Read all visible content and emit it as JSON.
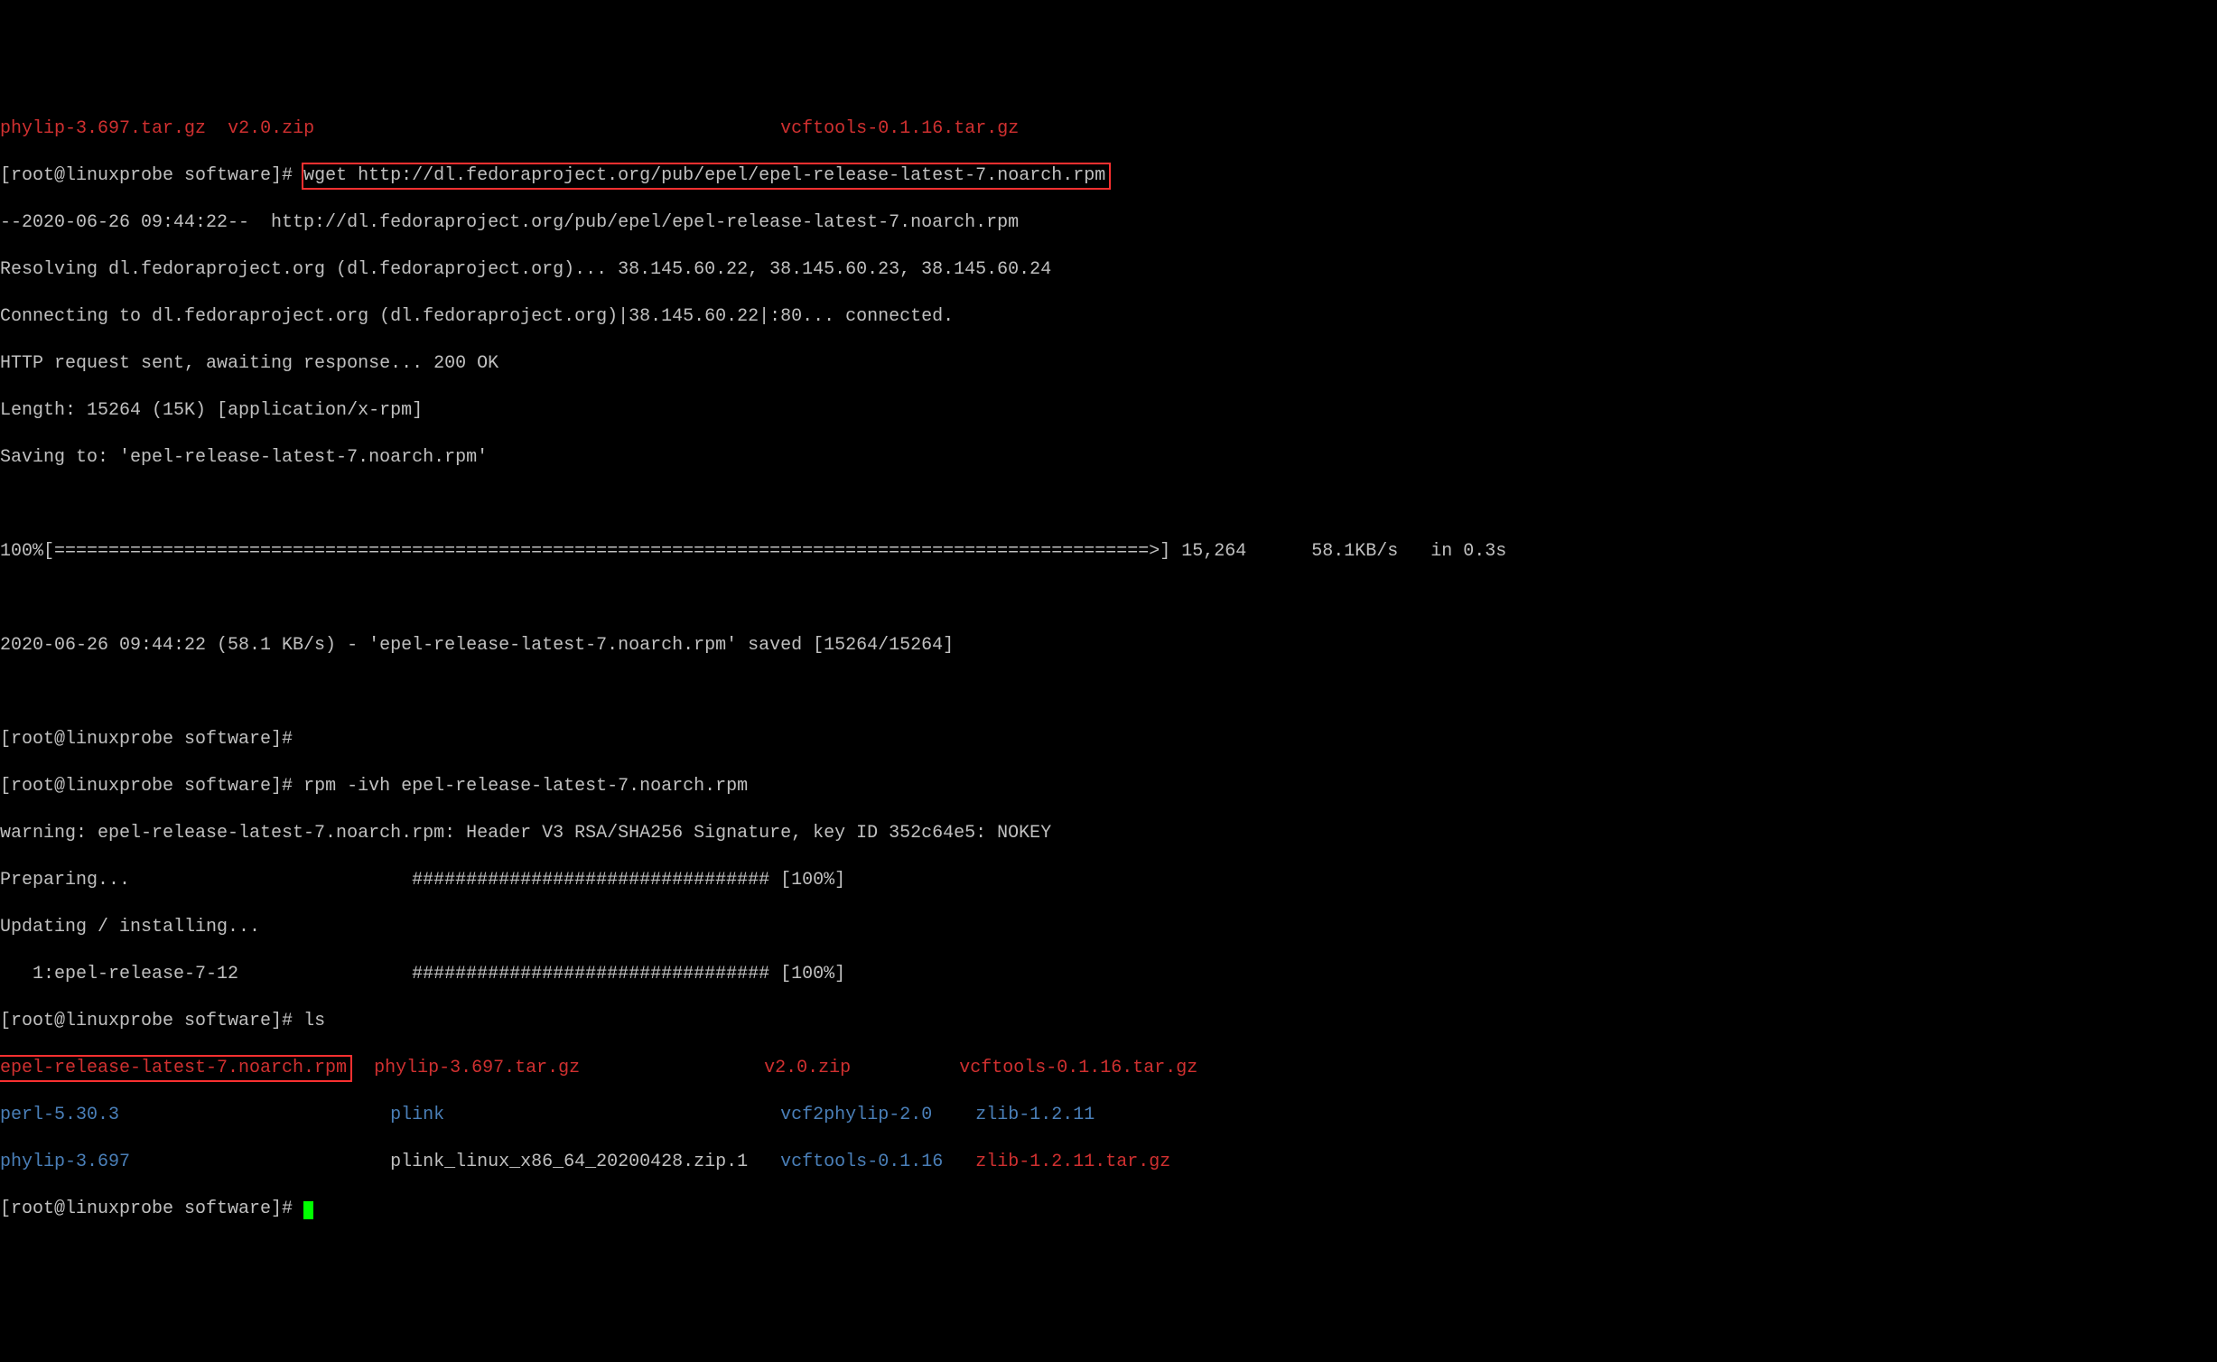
{
  "top_files": {
    "phylip": "phylip-3.697.tar.gz",
    "v20zip": "v2.0.zip",
    "vcftools": "vcftools-0.1.16.tar.gz"
  },
  "prompt1": "[root@linuxprobe software]# ",
  "wget_cmd": "wget http://dl.fedoraproject.org/pub/epel/epel-release-latest-7.noarch.rpm",
  "wget_out": {
    "l1": "--2020-06-26 09:44:22--  http://dl.fedoraproject.org/pub/epel/epel-release-latest-7.noarch.rpm",
    "l2": "Resolving dl.fedoraproject.org (dl.fedoraproject.org)... 38.145.60.22, 38.145.60.23, 38.145.60.24",
    "l3": "Connecting to dl.fedoraproject.org (dl.fedoraproject.org)|38.145.60.22|:80... connected.",
    "l4": "HTTP request sent, awaiting response... 200 OK",
    "l5": "Length: 15264 (15K) [application/x-rpm]",
    "l6": "Saving to: 'epel-release-latest-7.noarch.rpm'",
    "progress": "100%[=====================================================================================================>] 15,264      58.1KB/s   in 0.3s",
    "done": "2020-06-26 09:44:22 (58.1 KB/s) - 'epel-release-latest-7.noarch.rpm' saved [15264/15264]"
  },
  "rpm_cmd": "rpm -ivh epel-release-latest-7.noarch.rpm",
  "rpm_out": {
    "warn": "warning: epel-release-latest-7.noarch.rpm: Header V3 RSA/SHA256 Signature, key ID 352c64e5: NOKEY",
    "prep": "Preparing...                          ################################# [100%]",
    "upd": "Updating / installing...",
    "inst": "   1:epel-release-7-12                ################################# [100%]"
  },
  "ls_cmd": "ls",
  "ls": {
    "row1": {
      "c1": "epel-release-latest-7.noarch.rpm",
      "c2": "phylip-3.697.tar.gz",
      "c3": "v2.0.zip",
      "c4": "vcftools-0.1.16.tar.gz"
    },
    "row2": {
      "c1": "perl-5.30.3",
      "c2": "plink",
      "c3": "vcf2phylip-2.0",
      "c4": "zlib-1.2.11"
    },
    "row3": {
      "c1": "phylip-3.697",
      "c2": "plink_linux_x86_64_20200428.zip.1",
      "c3": "vcftools-0.1.16",
      "c4": "zlib-1.2.11.tar.gz"
    }
  }
}
